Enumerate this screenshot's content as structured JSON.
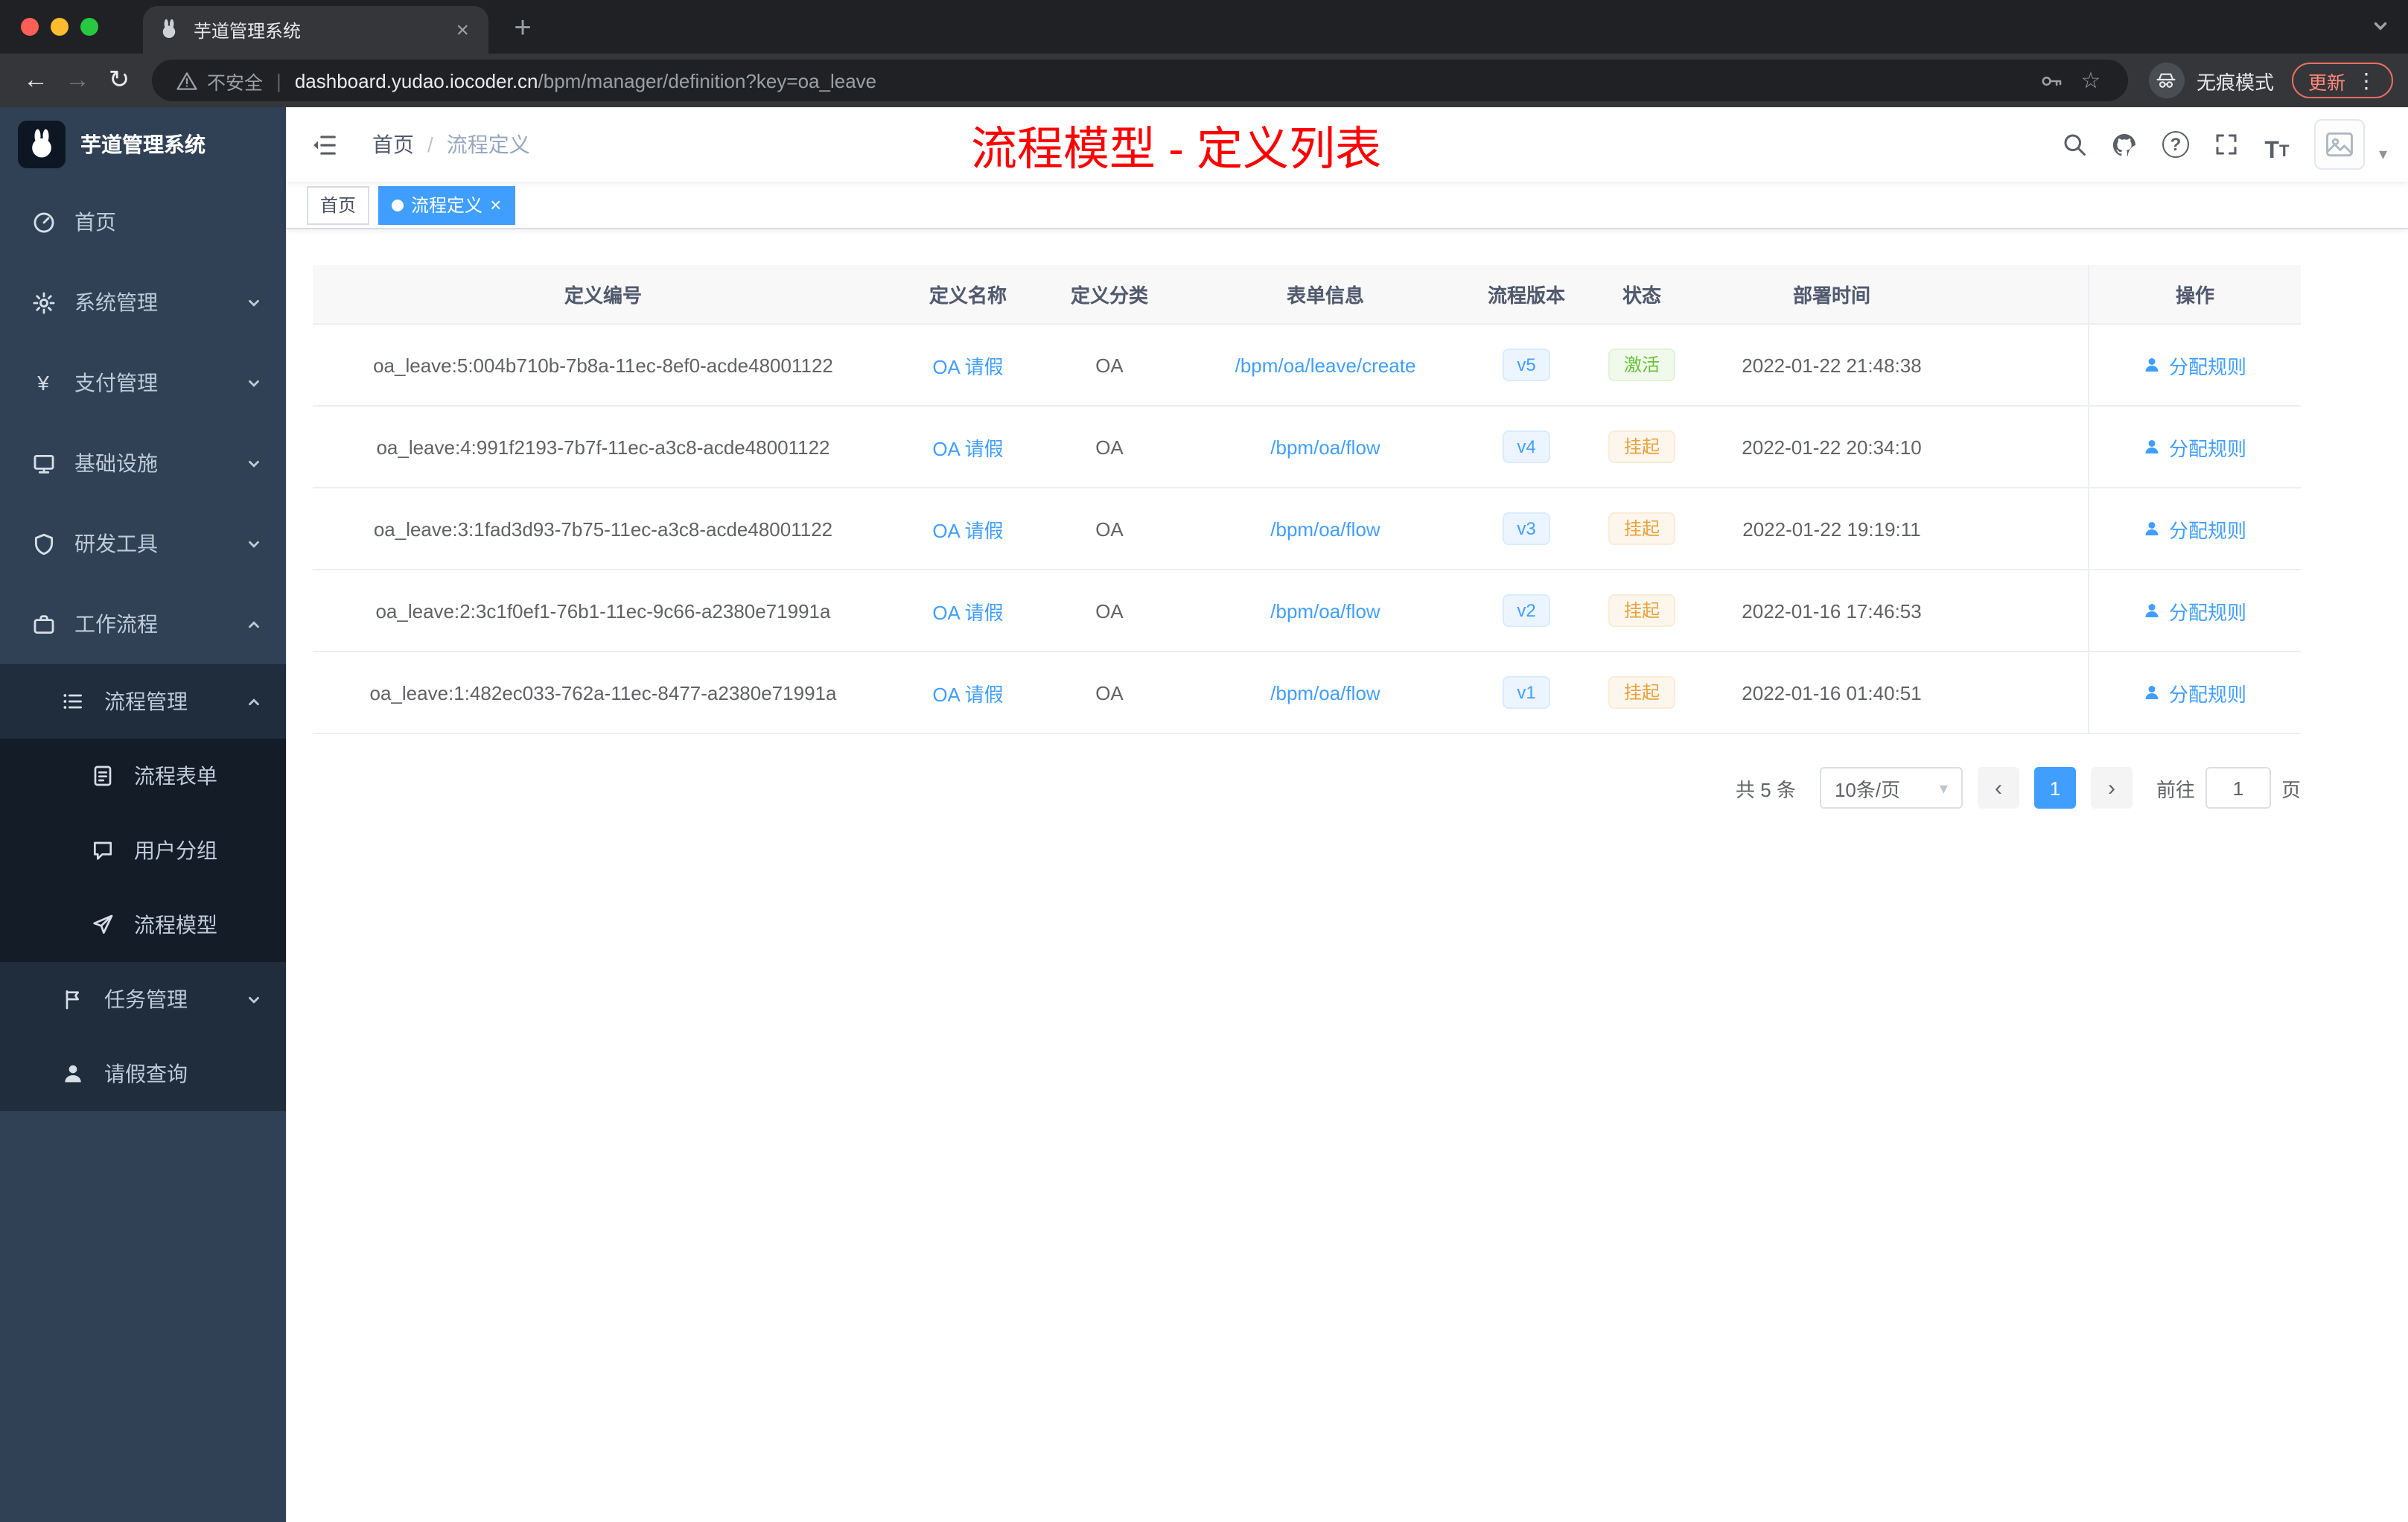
{
  "colors": {
    "accent_blue": "#409eff",
    "annotation_red": "#fe0000",
    "status_active_green": "#67c23a",
    "status_suspended_orange": "#e6a23c",
    "sidebar_bg": "#304156",
    "submenu_bg": "#1f2d3d"
  },
  "icons": {
    "close": "×",
    "plus": "+",
    "back": "←",
    "forward": "→",
    "reload": "↻",
    "star": "☆",
    "menu_dots": "⋮",
    "caret_down": "▾",
    "prev": "‹",
    "next": "›",
    "question": "?",
    "divider": "|",
    "yen": "¥",
    "font_large": "T",
    "font_small": "T"
  },
  "browser": {
    "tab_title": "芋道管理系统",
    "address": {
      "security_label": "不安全",
      "domain": "dashboard.yudao.iocoder.cn",
      "path": "/bpm/manager/definition?key=oa_leave"
    },
    "incognito_label": "无痕模式",
    "update_label": "更新"
  },
  "sidebar": {
    "app_title": "芋道管理系统",
    "menu": [
      {
        "label": "首页",
        "icon": "dashboard-icon"
      },
      {
        "label": "系统管理",
        "icon": "gear-icon"
      },
      {
        "label": "支付管理",
        "icon": "payment-icon"
      },
      {
        "label": "基础设施",
        "icon": "infrastructure-icon"
      },
      {
        "label": "研发工具",
        "icon": "dev-tools-icon"
      },
      {
        "label": "工作流程",
        "icon": "workflow-icon"
      },
      {
        "label": "流程管理",
        "icon": "process-list-icon"
      },
      {
        "label": "流程表单",
        "icon": "form-icon"
      },
      {
        "label": "用户分组",
        "icon": "user-group-icon"
      },
      {
        "label": "流程模型",
        "icon": "process-model-icon"
      },
      {
        "label": "任务管理",
        "icon": "task-icon"
      },
      {
        "label": "请假查询",
        "icon": "person-icon"
      }
    ]
  },
  "header": {
    "breadcrumb_home": "首页",
    "breadcrumb_separator": "/",
    "breadcrumb_current": "流程定义",
    "annotation": "流程模型 - 定义列表"
  },
  "tags": {
    "home": "首页",
    "active": "流程定义"
  },
  "table": {
    "columns": [
      "定义编号",
      "定义名称",
      "定义分类",
      "表单信息",
      "流程版本",
      "状态",
      "部署时间",
      "操作"
    ],
    "rows": [
      {
        "id": "oa_leave:5:004b710b-7b8a-11ec-8ef0-acde48001122",
        "name": "OA 请假",
        "category": "OA",
        "form": "/bpm/oa/leave/create",
        "version": "v5",
        "status": "激活",
        "time": "2022-01-22 21:48:38",
        "action": "分配规则"
      },
      {
        "id": "oa_leave:4:991f2193-7b7f-11ec-a3c8-acde48001122",
        "name": "OA 请假",
        "category": "OA",
        "form": "/bpm/oa/flow",
        "version": "v4",
        "status": "挂起",
        "time": "2022-01-22 20:34:10",
        "action": "分配规则"
      },
      {
        "id": "oa_leave:3:1fad3d93-7b75-11ec-a3c8-acde48001122",
        "name": "OA 请假",
        "category": "OA",
        "form": "/bpm/oa/flow",
        "version": "v3",
        "status": "挂起",
        "time": "2022-01-22 19:19:11",
        "action": "分配规则"
      },
      {
        "id": "oa_leave:2:3c1f0ef1-76b1-11ec-9c66-a2380e71991a",
        "name": "OA 请假",
        "category": "OA",
        "form": "/bpm/oa/flow",
        "version": "v2",
        "status": "挂起",
        "time": "2022-01-16 17:46:53",
        "action": "分配规则"
      },
      {
        "id": "oa_leave:1:482ec033-762a-11ec-8477-a2380e71991a",
        "name": "OA 请假",
        "category": "OA",
        "form": "/bpm/oa/flow",
        "version": "v1",
        "status": "挂起",
        "time": "2022-01-16 01:40:51",
        "action": "分配规则"
      }
    ]
  },
  "pagination": {
    "total": "共 5 条",
    "page_size": "10条/页",
    "current_page": "1",
    "goto_label": "前往",
    "goto_value": "1",
    "goto_unit": "页"
  }
}
